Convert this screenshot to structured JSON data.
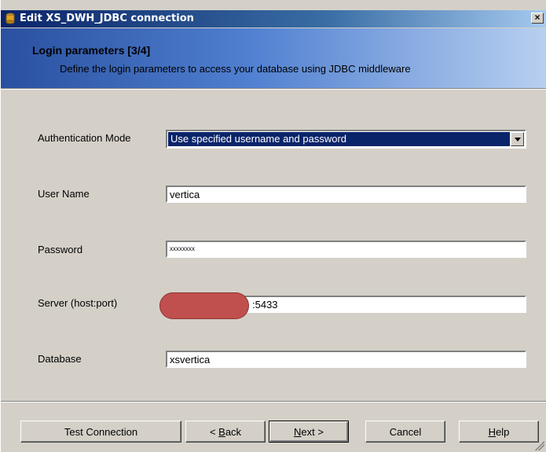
{
  "window": {
    "title": "Edit XS_DWH_JDBC connection",
    "close_symbol": "×"
  },
  "header": {
    "title": "Login parameters [3/4]",
    "description": "Define the login parameters to access your database using JDBC middleware"
  },
  "form": {
    "authentication_mode": {
      "label": "Authentication Mode",
      "value": "Use specified username and password"
    },
    "user_name": {
      "label": "User Name",
      "value": "vertica"
    },
    "password": {
      "label": "Password",
      "value": "xxxxxxxx"
    },
    "server": {
      "label": "Server (host:port)",
      "value_visible": ":5433"
    },
    "database": {
      "label": "Database",
      "value": "xsvertica"
    }
  },
  "buttons": {
    "test_connection": "Test Connection",
    "back_prefix": "< ",
    "back_mnemonic": "B",
    "back_rest": "ack",
    "next_mnemonic": "N",
    "next_rest": "ext >",
    "cancel": "Cancel",
    "help_mnemonic": "H",
    "help_rest": "elp"
  },
  "colors": {
    "titlebar": "#0a246a",
    "header_band": "#4f7fd0",
    "redaction": "#c0504d",
    "dialog": "#d4d0c8"
  }
}
